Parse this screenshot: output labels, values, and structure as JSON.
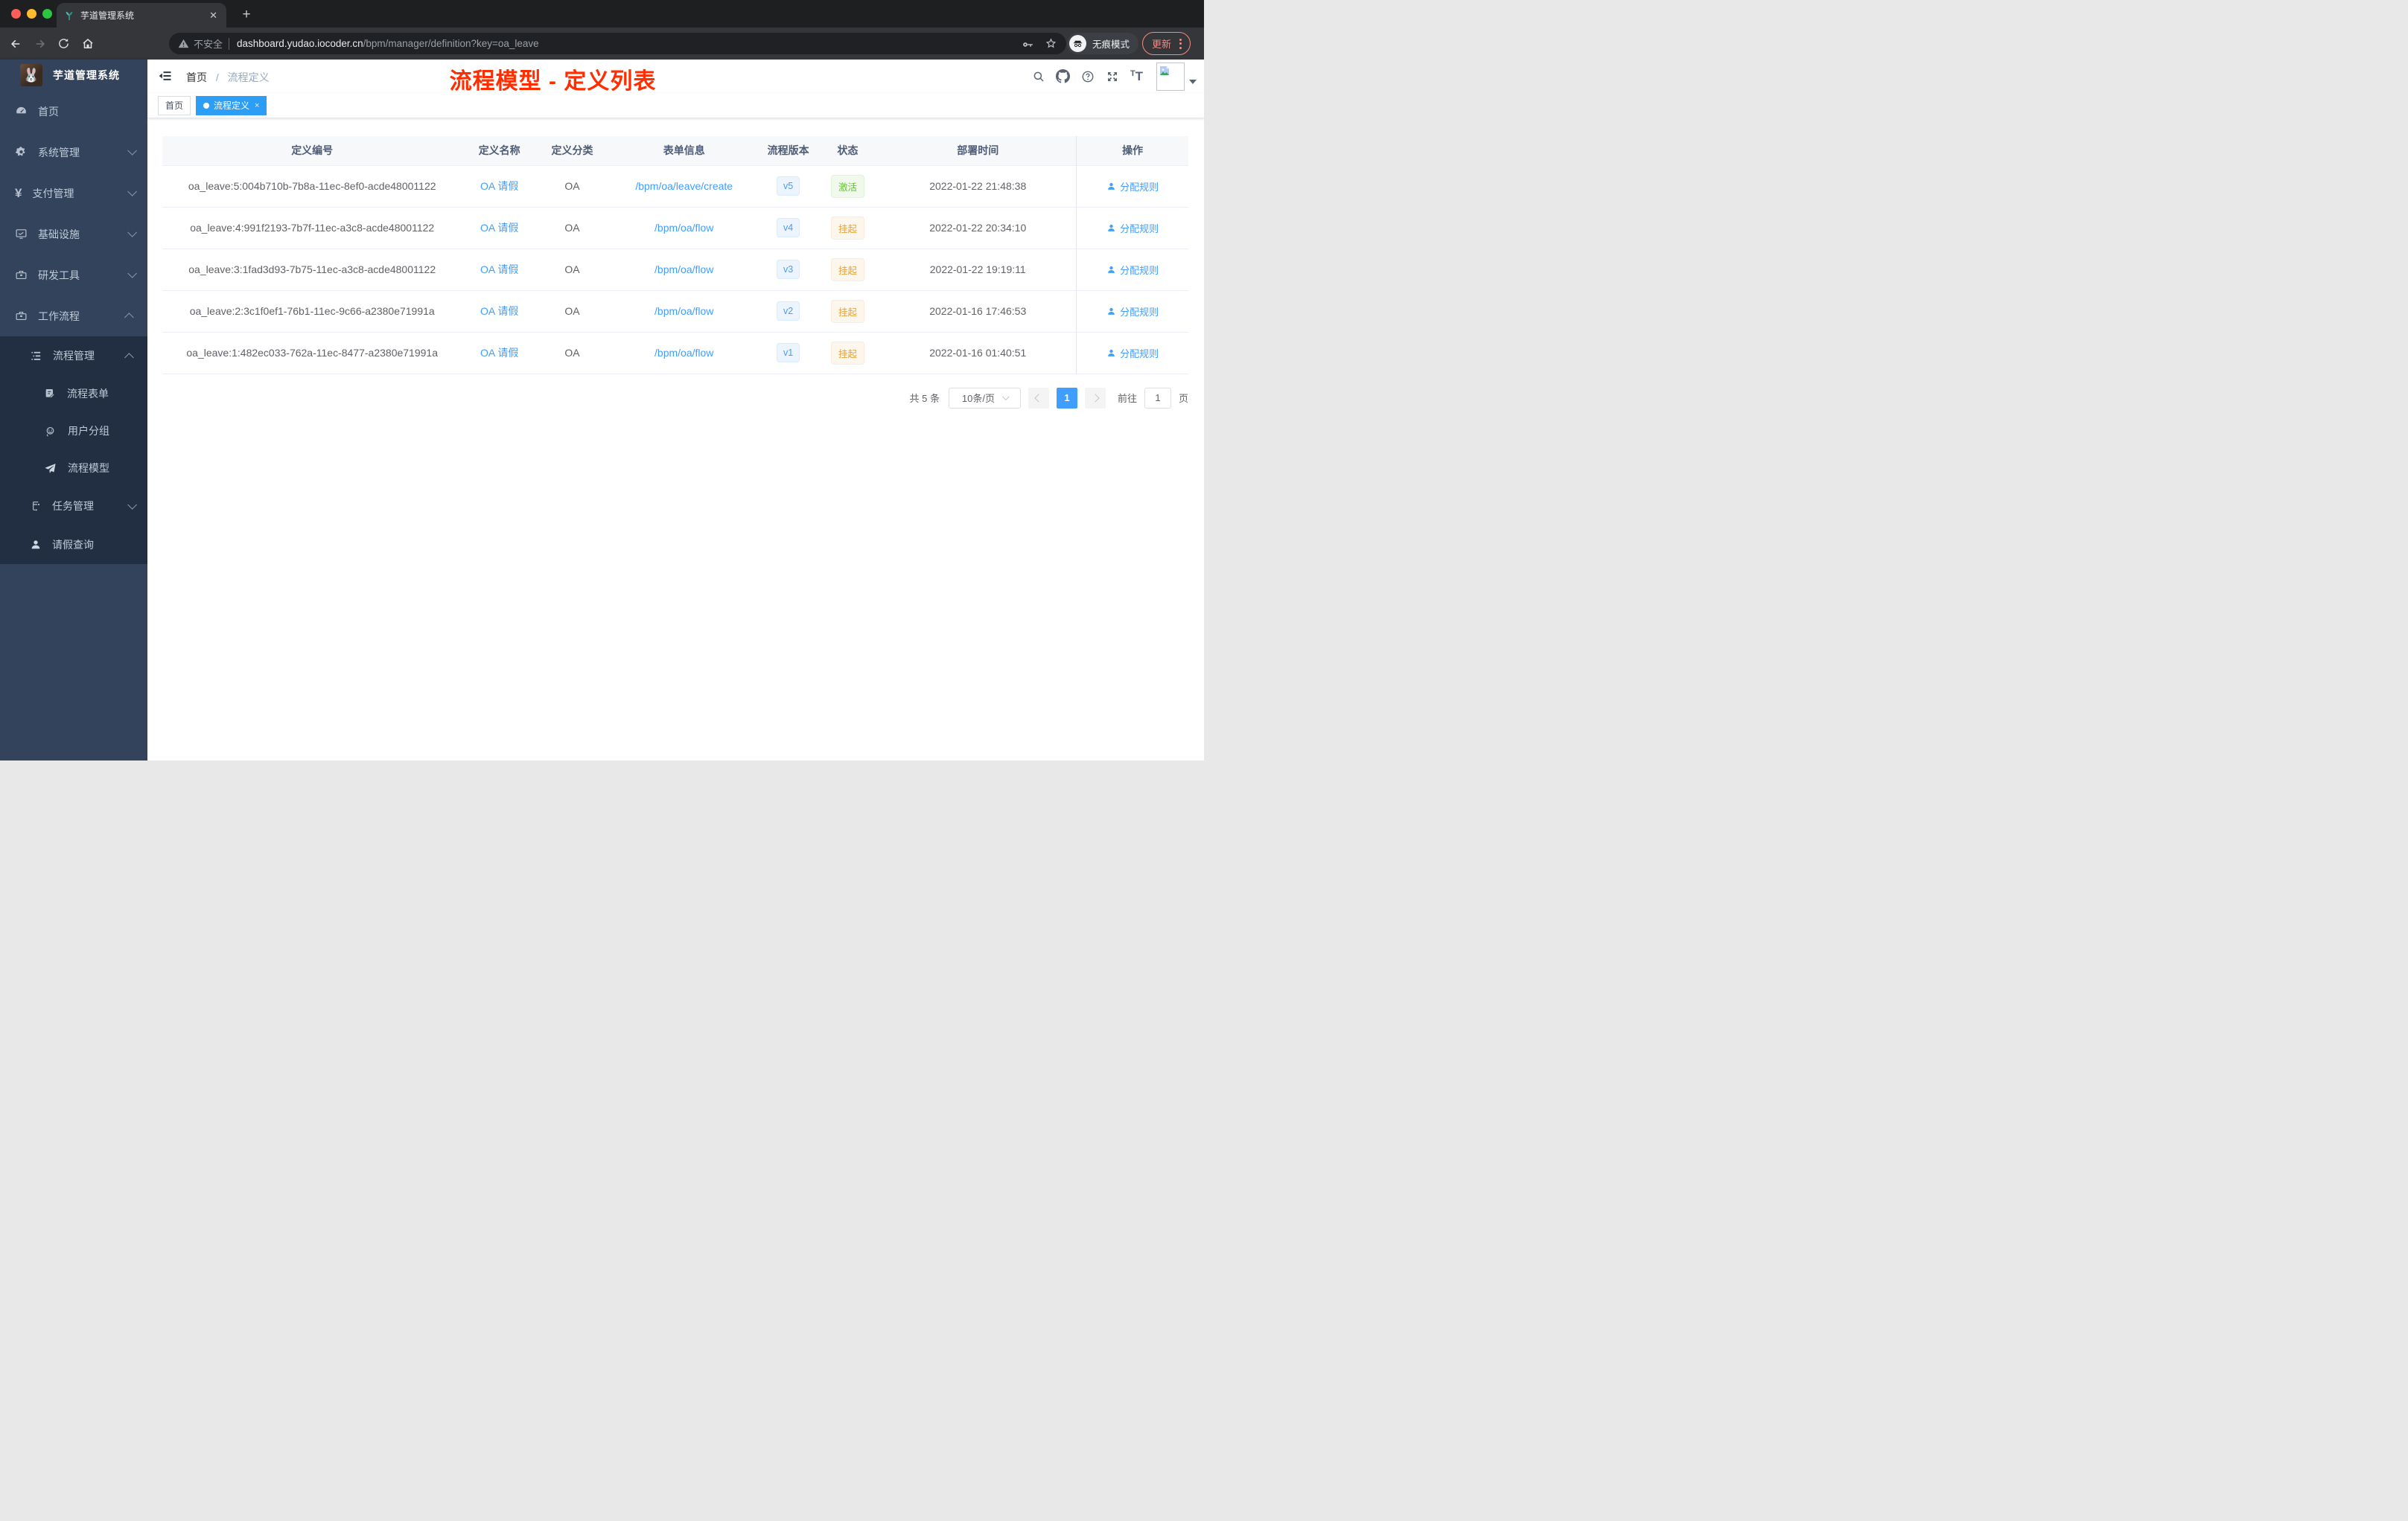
{
  "browser": {
    "tab_title": "芋道管理系统",
    "new_tab_label": "+",
    "close_tab_label": "✕",
    "not_secure_label": "不安全",
    "url_host": "dashboard.yudao.iocoder.cn",
    "url_path": "/bpm/manager/definition?key=oa_leave",
    "incognito_label": "无痕模式",
    "update_label": "更新"
  },
  "sidebar": {
    "app_title": "芋道管理系统",
    "items": [
      {
        "label": "首页",
        "icon": "dashboard-icon",
        "level": 1
      },
      {
        "label": "系统管理",
        "icon": "gear-icon",
        "level": 1,
        "arrow": "down"
      },
      {
        "label": "支付管理",
        "icon": "yen-icon",
        "level": 1,
        "arrow": "down"
      },
      {
        "label": "基础设施",
        "icon": "monitor-icon",
        "level": 1,
        "arrow": "down"
      },
      {
        "label": "研发工具",
        "icon": "toolbox-icon",
        "level": 1,
        "arrow": "down"
      },
      {
        "label": "工作流程",
        "icon": "briefcase-icon",
        "level": 1,
        "arrow": "up"
      },
      {
        "label": "流程管理",
        "icon": "tree-list-icon",
        "level": 2,
        "arrow": "up"
      },
      {
        "label": "流程表单",
        "icon": "form-icon",
        "level": 3
      },
      {
        "label": "用户分组",
        "icon": "people-icon",
        "level": 3
      },
      {
        "label": "流程模型",
        "icon": "paper-plane-icon",
        "level": 3
      },
      {
        "label": "任务管理",
        "icon": "flow-icon",
        "level": 2,
        "arrow": "down"
      },
      {
        "label": "请假查询",
        "icon": "user-icon",
        "level": 2
      }
    ]
  },
  "header": {
    "breadcrumb_home": "首页",
    "breadcrumb_sep": "/",
    "breadcrumb_current": "流程定义",
    "annotation": "流程模型 - 定义列表"
  },
  "tags": {
    "home_label": "首页",
    "active_label": "流程定义",
    "active_close": "×"
  },
  "table": {
    "columns": [
      "定义编号",
      "定义名称",
      "定义分类",
      "表单信息",
      "流程版本",
      "状态",
      "部署时间",
      "操作"
    ],
    "rows": [
      {
        "id": "oa_leave:5:004b710b-7b8a-11ec-8ef0-acde48001122",
        "name": "OA 请假",
        "category": "OA",
        "form": "/bpm/oa/leave/create",
        "version": "v5",
        "status": "激活",
        "deploy_time": "2022-01-22 21:48:38",
        "action": "分配规则"
      },
      {
        "id": "oa_leave:4:991f2193-7b7f-11ec-a3c8-acde48001122",
        "name": "OA 请假",
        "category": "OA",
        "form": "/bpm/oa/flow",
        "version": "v4",
        "status": "挂起",
        "deploy_time": "2022-01-22 20:34:10",
        "action": "分配规则"
      },
      {
        "id": "oa_leave:3:1fad3d93-7b75-11ec-a3c8-acde48001122",
        "name": "OA 请假",
        "category": "OA",
        "form": "/bpm/oa/flow",
        "version": "v3",
        "status": "挂起",
        "deploy_time": "2022-01-22 19:19:11",
        "action": "分配规则"
      },
      {
        "id": "oa_leave:2:3c1f0ef1-76b1-11ec-9c66-a2380e71991a",
        "name": "OA 请假",
        "category": "OA",
        "form": "/bpm/oa/flow",
        "version": "v2",
        "status": "挂起",
        "deploy_time": "2022-01-16 17:46:53",
        "action": "分配规则"
      },
      {
        "id": "oa_leave:1:482ec033-762a-11ec-8477-a2380e71991a",
        "name": "OA 请假",
        "category": "OA",
        "form": "/bpm/oa/flow",
        "version": "v1",
        "status": "挂起",
        "deploy_time": "2022-01-16 01:40:51",
        "action": "分配规则"
      }
    ]
  },
  "pagination": {
    "total_label": "共 5 条",
    "page_size_label": "10条/页",
    "current_page": "1",
    "goto_label": "前往",
    "goto_value": "1",
    "page_unit_label": "页"
  },
  "colors": {
    "accent": "#409eff",
    "success": "#67c23a",
    "warning": "#e6a23c",
    "annotation_red": "#ff2d00",
    "sidebar_bg": "#33435c",
    "submenu_bg": "#222f42",
    "chrome_update": "#f28b82"
  }
}
